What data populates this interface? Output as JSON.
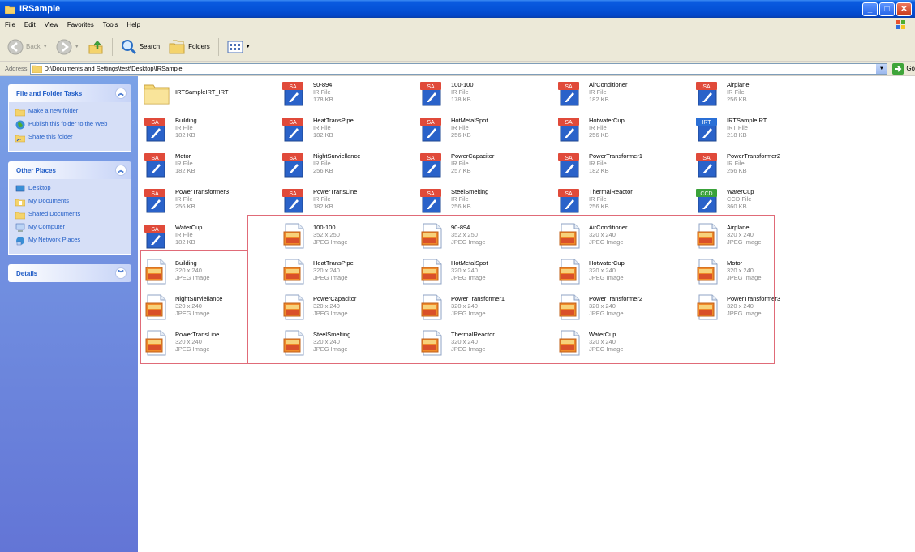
{
  "window": {
    "title": "IRSample",
    "controls": [
      "minimize",
      "maximize",
      "close"
    ]
  },
  "menu": [
    "File",
    "Edit",
    "View",
    "Favorites",
    "Tools",
    "Help"
  ],
  "toolbar": {
    "back_label": "Back",
    "search_label": "Search",
    "folders_label": "Folders"
  },
  "address": {
    "label": "Address",
    "path": "D:\\Documents and Settings\\test\\Desktop\\IRSample",
    "go_label": "Go"
  },
  "taskpane": {
    "file_tasks": {
      "title": "File and Folder Tasks",
      "items": [
        "Make a new folder",
        "Publish this folder to the Web",
        "Share this folder"
      ]
    },
    "other_places": {
      "title": "Other Places",
      "items": [
        "Desktop",
        "My Documents",
        "Shared Documents",
        "My Computer",
        "My Network Places"
      ]
    },
    "details": {
      "title": "Details"
    }
  },
  "files": [
    {
      "name": "IRTSampleIRT_IRT",
      "l1": "",
      "l2": "",
      "kind": "folder"
    },
    {
      "name": "90-894",
      "l1": "IR File",
      "l2": "178 KB",
      "kind": "ir",
      "badge": "SA"
    },
    {
      "name": "100-100",
      "l1": "IR File",
      "l2": "178 KB",
      "kind": "ir",
      "badge": "SA"
    },
    {
      "name": "AirConditioner",
      "l1": "IR File",
      "l2": "182 KB",
      "kind": "ir",
      "badge": "SA"
    },
    {
      "name": "Airplane",
      "l1": "IR File",
      "l2": "256 KB",
      "kind": "ir",
      "badge": "SA"
    },
    {
      "name": "Building",
      "l1": "IR File",
      "l2": "182 KB",
      "kind": "ir",
      "badge": "SA"
    },
    {
      "name": "HeatTransPipe",
      "l1": "IR File",
      "l2": "182 KB",
      "kind": "ir",
      "badge": "SA"
    },
    {
      "name": "HotMetalSpot",
      "l1": "IR File",
      "l2": "256 KB",
      "kind": "ir",
      "badge": "SA"
    },
    {
      "name": "HotwaterCup",
      "l1": "IR File",
      "l2": "256 KB",
      "kind": "ir",
      "badge": "SA"
    },
    {
      "name": "IRTSampleIRT",
      "l1": "IRT File",
      "l2": "218 KB",
      "kind": "irt",
      "badge": "IRT"
    },
    {
      "name": "Motor",
      "l1": "IR File",
      "l2": "182 KB",
      "kind": "ir",
      "badge": "SA"
    },
    {
      "name": "NightSurviellance",
      "l1": "IR File",
      "l2": "256 KB",
      "kind": "ir",
      "badge": "SA"
    },
    {
      "name": "PowerCapacitor",
      "l1": "IR File",
      "l2": "257 KB",
      "kind": "ir",
      "badge": "SA"
    },
    {
      "name": "PowerTransformer1",
      "l1": "IR File",
      "l2": "182 KB",
      "kind": "ir",
      "badge": "SA"
    },
    {
      "name": "PowerTransformer2",
      "l1": "IR File",
      "l2": "256 KB",
      "kind": "ir",
      "badge": "SA"
    },
    {
      "name": "PowerTransformer3",
      "l1": "IR File",
      "l2": "256 KB",
      "kind": "ir",
      "badge": "SA"
    },
    {
      "name": "PowerTransLine",
      "l1": "IR File",
      "l2": "182 KB",
      "kind": "ir",
      "badge": "SA"
    },
    {
      "name": "SteelSmelting",
      "l1": "IR File",
      "l2": "256 KB",
      "kind": "ir",
      "badge": "SA"
    },
    {
      "name": "ThermalReactor",
      "l1": "IR File",
      "l2": "256 KB",
      "kind": "ir",
      "badge": "SA"
    },
    {
      "name": "WaterCup",
      "l1": "CCD File",
      "l2": "360 KB",
      "kind": "ccd",
      "badge": "CCD"
    },
    {
      "name": "WaterCup",
      "l1": "IR File",
      "l2": "182 KB",
      "kind": "ir",
      "badge": "SA"
    },
    {
      "name": "100-100",
      "l1": "352 x 250",
      "l2": "JPEG Image",
      "kind": "jpeg"
    },
    {
      "name": "90-894",
      "l1": "352 x 250",
      "l2": "JPEG Image",
      "kind": "jpeg"
    },
    {
      "name": "AirConditioner",
      "l1": "320 x 240",
      "l2": "JPEG Image",
      "kind": "jpeg"
    },
    {
      "name": "Airplane",
      "l1": "320 x 240",
      "l2": "JPEG Image",
      "kind": "jpeg"
    },
    {
      "name": "Building",
      "l1": "320 x 240",
      "l2": "JPEG Image",
      "kind": "jpeg"
    },
    {
      "name": "HeatTransPipe",
      "l1": "320 x 240",
      "l2": "JPEG Image",
      "kind": "jpeg"
    },
    {
      "name": "HotMetalSpot",
      "l1": "320 x 240",
      "l2": "JPEG Image",
      "kind": "jpeg"
    },
    {
      "name": "HotwaterCup",
      "l1": "320 x 240",
      "l2": "JPEG Image",
      "kind": "jpeg"
    },
    {
      "name": "Motor",
      "l1": "320 x 240",
      "l2": "JPEG Image",
      "kind": "jpeg"
    },
    {
      "name": "NightSurviellance",
      "l1": "320 x 240",
      "l2": "JPEG Image",
      "kind": "jpeg"
    },
    {
      "name": "PowerCapacitor",
      "l1": "320 x 240",
      "l2": "JPEG Image",
      "kind": "jpeg"
    },
    {
      "name": "PowerTransformer1",
      "l1": "320 x 240",
      "l2": "JPEG Image",
      "kind": "jpeg"
    },
    {
      "name": "PowerTransformer2",
      "l1": "320 x 240",
      "l2": "JPEG Image",
      "kind": "jpeg"
    },
    {
      "name": "PowerTransformer3",
      "l1": "320 x 240",
      "l2": "JPEG Image",
      "kind": "jpeg"
    },
    {
      "name": "PowerTransLine",
      "l1": "320 x 240",
      "l2": "JPEG Image",
      "kind": "jpeg"
    },
    {
      "name": "SteelSmelting",
      "l1": "320 x 240",
      "l2": "JPEG Image",
      "kind": "jpeg"
    },
    {
      "name": "ThermalReactor",
      "l1": "320 x 240",
      "l2": "JPEG Image",
      "kind": "jpeg"
    },
    {
      "name": "WaterCup",
      "l1": "320 x 240",
      "l2": "JPEG Image",
      "kind": "jpeg"
    }
  ],
  "colors": {
    "titlebar": "#0553d8",
    "taskpane": "#6f8ddf",
    "link": "#215dc6",
    "highlight_box": "#e06b78",
    "ir_badge": "#e04a3a",
    "ccd_badge": "#3aa23a",
    "irt_badge": "#2a6fd6"
  }
}
